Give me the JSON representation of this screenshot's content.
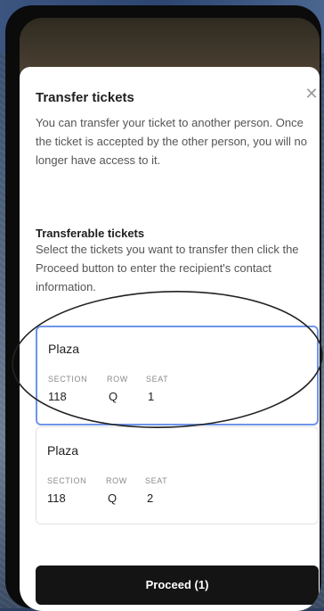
{
  "dialog": {
    "title": "Transfer tickets",
    "close_symbol": "✕",
    "description": "You can transfer your ticket to another person. Once the ticket is accepted by the other person, you will no longer have access to it."
  },
  "transferable": {
    "title": "Transferable tickets",
    "description": "Select the tickets you want to transfer then click the Proceed button to enter the recipient's contact information."
  },
  "column_labels": {
    "section": "SECTION",
    "row": "ROW",
    "seat": "SEAT"
  },
  "tickets": [
    {
      "venue": "Plaza",
      "section": "118",
      "row": "Q",
      "seat": "1",
      "selected": true
    },
    {
      "venue": "Plaza",
      "section": "118",
      "row": "Q",
      "seat": "2",
      "selected": false
    }
  ],
  "proceed_button": {
    "label": "Proceed (1)"
  },
  "colors": {
    "selected_border": "#6f95e8",
    "button_bg": "#141414",
    "annotation_ink": "#222222"
  }
}
